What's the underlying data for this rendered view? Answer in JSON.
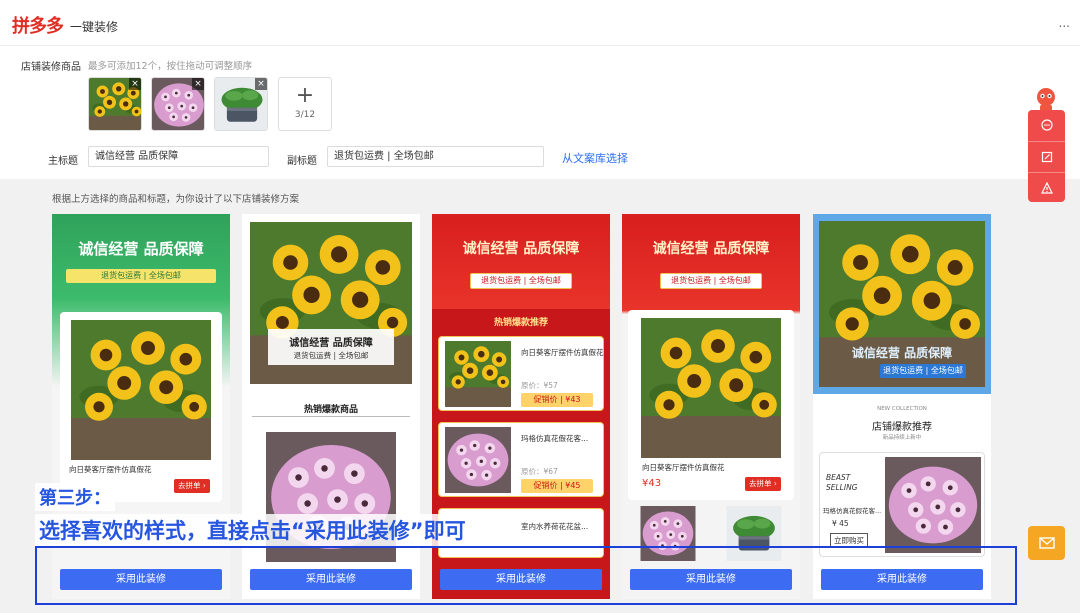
{
  "header": {
    "logo": "拼多多",
    "subtitle": "一键装修",
    "more": "..."
  },
  "config": {
    "products_label": "店铺装修商品",
    "products_hint": "最多可添加12个，按住拖动可调整顺序",
    "thumb_remove": "×",
    "add_icon": "+",
    "add_count": "3/12",
    "main_title_label": "主标题",
    "main_title_value": "诚信经营  品质保障",
    "sub_title_label": "副标题",
    "sub_title_value": "退货包运费 | 全场包邮",
    "library_link": "从文案库选择"
  },
  "gallery": {
    "hint": "根据上方选择的商品和标题，为你设计了以下店铺装修方案",
    "use_label": "采用此装修",
    "card_text": {
      "title": "诚信经营  品质保障",
      "subtitle": "退货包运费 | 全场包邮",
      "hot_goods": "热销爆款商品",
      "hot_recommend": "热销爆款推荐",
      "shop_hot": "店铺爆款推荐",
      "new_collection": "NEW COLLECTION",
      "new_tag": "新品持续上新中",
      "beast": "BEAST",
      "selling": "SELLING",
      "prod1": "向日葵客厅摆件仿真假花",
      "prod2": "玛格仿真花假花客...",
      "prod3": "室内水养荷花花盆...",
      "prod_short": "玛格仿真花假花客...",
      "buy": "去拼单 ›",
      "orig1": "原价：¥57",
      "promo1": "促销价 | ¥43",
      "orig2": "原价：¥67",
      "promo2": "促销价 | ¥45",
      "price43": "¥43",
      "price45": "¥ 45",
      "buy_now": "立即购买"
    }
  },
  "overlay": {
    "step": "第三步：",
    "instruction": "选择喜欢的样式，直接点击“采用此装修”即可"
  },
  "side_toolbar": {
    "icons": [
      "chat-icon",
      "edit-icon",
      "warning-icon"
    ],
    "mail_icon": "mail-icon"
  },
  "colors": {
    "pdd_red": "#e02e24",
    "button_blue": "#3d6cf2",
    "highlight_blue": "#1e40d8",
    "mail_orange": "#f5a623"
  }
}
